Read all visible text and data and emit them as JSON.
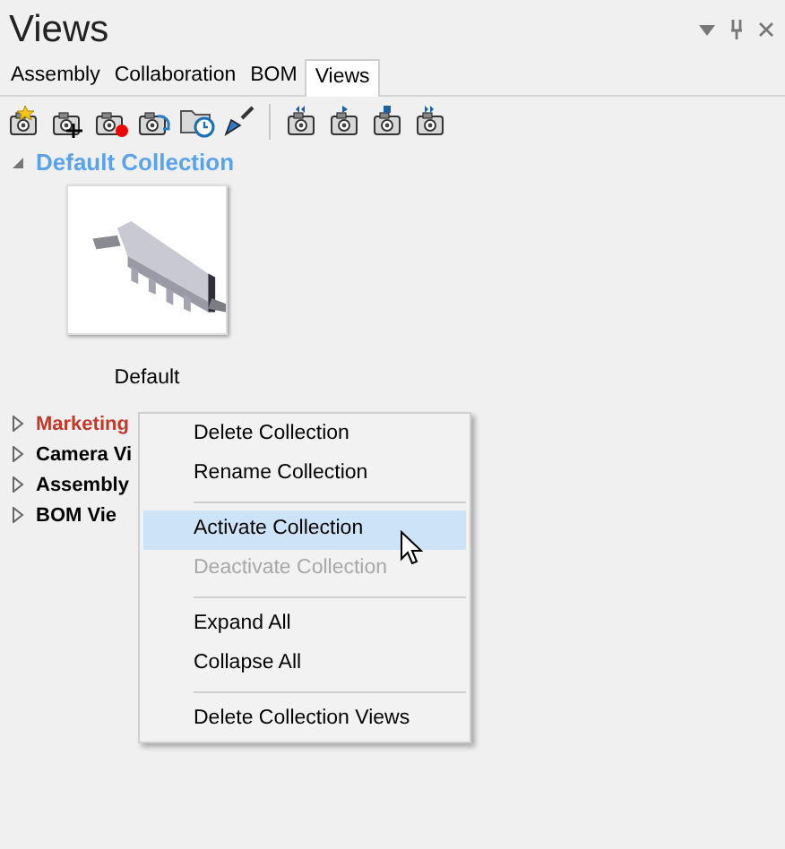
{
  "panel": {
    "title": "Views"
  },
  "tabs": [
    {
      "label": "Assembly",
      "selected": false
    },
    {
      "label": "Collaboration",
      "selected": false
    },
    {
      "label": "BOM",
      "selected": false
    },
    {
      "label": "Views",
      "selected": true
    }
  ],
  "default_collection": {
    "label": "Default Collection",
    "expanded": true,
    "views": [
      {
        "label": "Default",
        "kind": "picture"
      }
    ]
  },
  "collections": [
    {
      "label": "Marketing",
      "expanded": false,
      "color": "#c0392b"
    },
    {
      "label": "Camera Vi",
      "expanded": false,
      "color": "#000000"
    },
    {
      "label": "Assembly",
      "expanded": false,
      "color": "#000000"
    },
    {
      "label": "BOM Vie",
      "expanded": false,
      "color": "#000000"
    }
  ],
  "context_menu": [
    {
      "label": "Delete Collection",
      "selected": false,
      "disabled": false,
      "separator_before": false
    },
    {
      "label": "Rename Collection",
      "selected": false,
      "disabled": false,
      "separator_before": false
    },
    {
      "label": "Activate Collection",
      "selected": true,
      "disabled": false,
      "separator_before": true
    },
    {
      "label": "Deactivate Collection",
      "selected": false,
      "disabled": true,
      "separator_before": false
    },
    {
      "label": "Expand All",
      "selected": false,
      "disabled": false,
      "separator_before": true
    },
    {
      "label": "Collapse All",
      "selected": false,
      "disabled": false,
      "separator_before": false
    },
    {
      "label": "Delete Collection Views",
      "selected": false,
      "disabled": false,
      "separator_before": true
    }
  ]
}
